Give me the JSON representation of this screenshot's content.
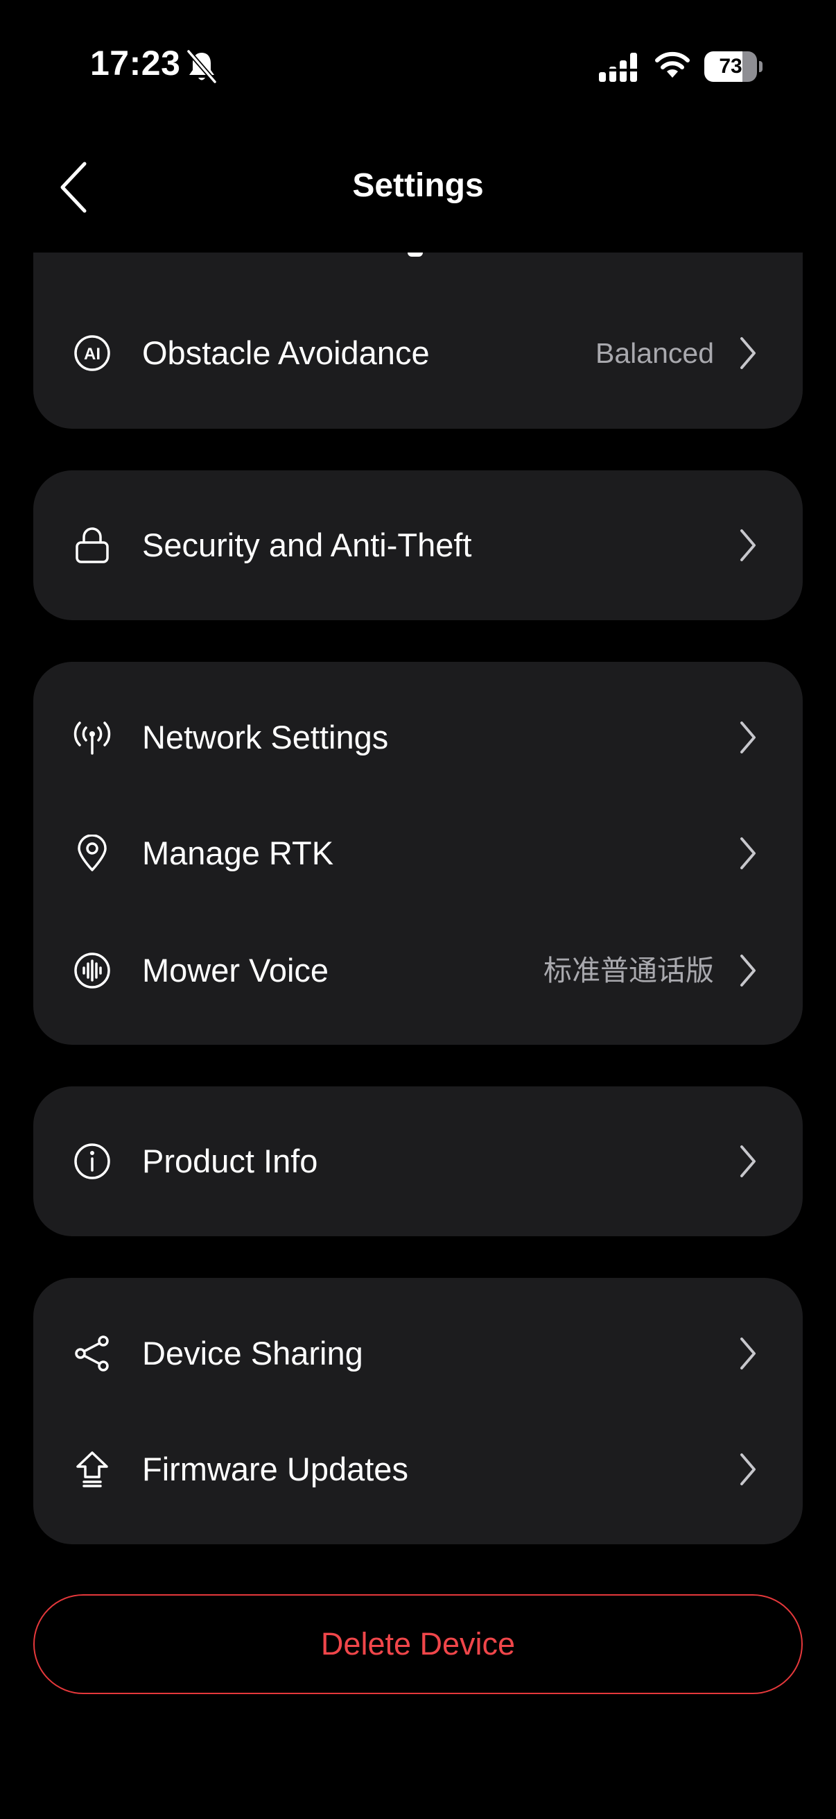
{
  "status_bar": {
    "time": "17:23",
    "battery": "73",
    "battery_level": 0.73
  },
  "header": {
    "title": "Settings"
  },
  "sections": {
    "ai": [
      {
        "label": "Obstacle Avoidance",
        "value": "Balanced",
        "icon": "ai-icon"
      }
    ],
    "security": [
      {
        "label": "Security and Anti-Theft",
        "icon": "lock-icon"
      }
    ],
    "network": [
      {
        "label": "Network Settings",
        "icon": "antenna-icon"
      },
      {
        "label": "Manage RTK",
        "icon": "location-pin-icon"
      },
      {
        "label": "Mower Voice",
        "value": "标准普通话版",
        "icon": "voice-wave-icon"
      }
    ],
    "info": [
      {
        "label": "Product Info",
        "icon": "info-icon"
      }
    ],
    "device": [
      {
        "label": "Device Sharing",
        "icon": "share-icon"
      },
      {
        "label": "Firmware Updates",
        "icon": "upload-arrow-icon"
      }
    ]
  },
  "delete_button": {
    "label": "Delete Device"
  },
  "colors": {
    "background": "#000000",
    "card": "#1c1c1e",
    "secondary_text": "#a9a9ae",
    "danger": "#e5383b"
  }
}
